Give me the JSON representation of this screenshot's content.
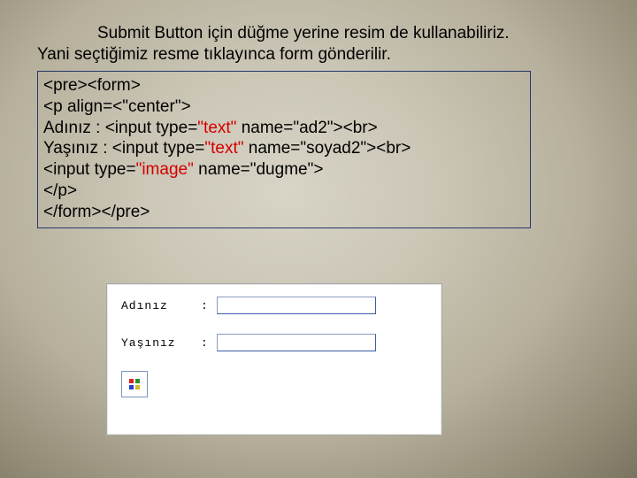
{
  "intro": {
    "line1": "Submit Button için düğme yerine resim de kullanabiliriz.",
    "line2": "Yani seçtiğimiz resme tıklayınca form gönderilir."
  },
  "code": {
    "l1": "<pre><form>",
    "l2": "<p align=<\"center\">",
    "l3a": "Adınız : <input type=",
    "l3b": "\"text\"",
    "l3c": " name=\"ad2\"><br>",
    "l4a": "Yaşınız : <input type=",
    "l4b": "\"text\"",
    "l4c": " name=\"soyad2\"><br>",
    "l5a": "<input type=",
    "l5b": "\"image\"",
    "l5c": " name=\"dugme\">",
    "l6": "</p>",
    "l7": "</form></pre>"
  },
  "preview": {
    "label_ad": "Adınız",
    "label_yas": "Yaşınız",
    "colon": ":",
    "value_ad": "",
    "value_yas": ""
  }
}
